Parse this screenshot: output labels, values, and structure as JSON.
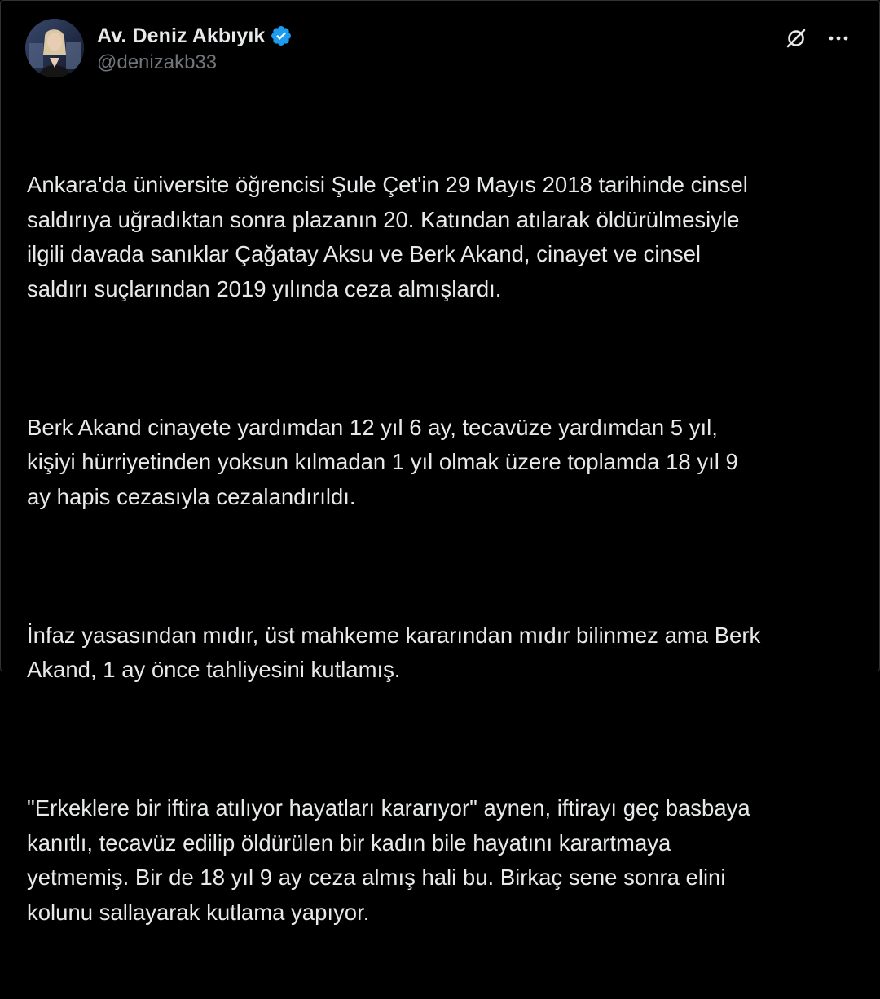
{
  "author": {
    "display_name": "Av. Deniz Akbıyık",
    "handle": "@denizakb33",
    "verified": true,
    "verified_color": "#1d9bf0"
  },
  "header_actions": {
    "grok_icon": "slashed-circle-icon",
    "more_icon": "more-horizontal-icon"
  },
  "tweet": {
    "paragraphs": [
      "Ankara'da üniversite öğrencisi Şule Çet'in 29 Mayıs 2018 tarihinde cinsel\nsaldırıya uğradıktan sonra plazanın 20. Katından atılarak öldürülmesiyle\nilgili davada sanıklar Çağatay Aksu ve Berk Akand, cinayet ve cinsel\nsaldırı suçlarından 2019 yılında ceza almışlardı.",
      "Berk Akand cinayete yardımdan 12 yıl 6 ay, tecavüze yardımdan 5 yıl,\nkişiyi hürriyetinden yoksun kılmadan 1 yıl olmak üzere toplamda 18 yıl 9\nay hapis cezasıyla cezalandırıldı.",
      "İnfaz yasasından mıdır, üst mahkeme kararından mıdır bilinmez ama Berk\nAkand, 1 ay önce tahliyesini kutlamış.",
      "\"Erkeklere bir iftira atılıyor hayatları kararıyor\" aynen, iftirayı geç basbaya\nkanıtlı, tecavüz edilip öldürülen bir kadın bile hayatını karartmaya\nyetmemiş. Bir de 18 yıl 9 ay ceza almış hali bu. Birkaç sene sonra elini\nkolunu sallayarak kutlama yapıyor."
    ]
  },
  "colors": {
    "background": "#000000",
    "text_primary": "#e7e9ea",
    "text_secondary": "#71767b",
    "border": "#2f3336"
  }
}
